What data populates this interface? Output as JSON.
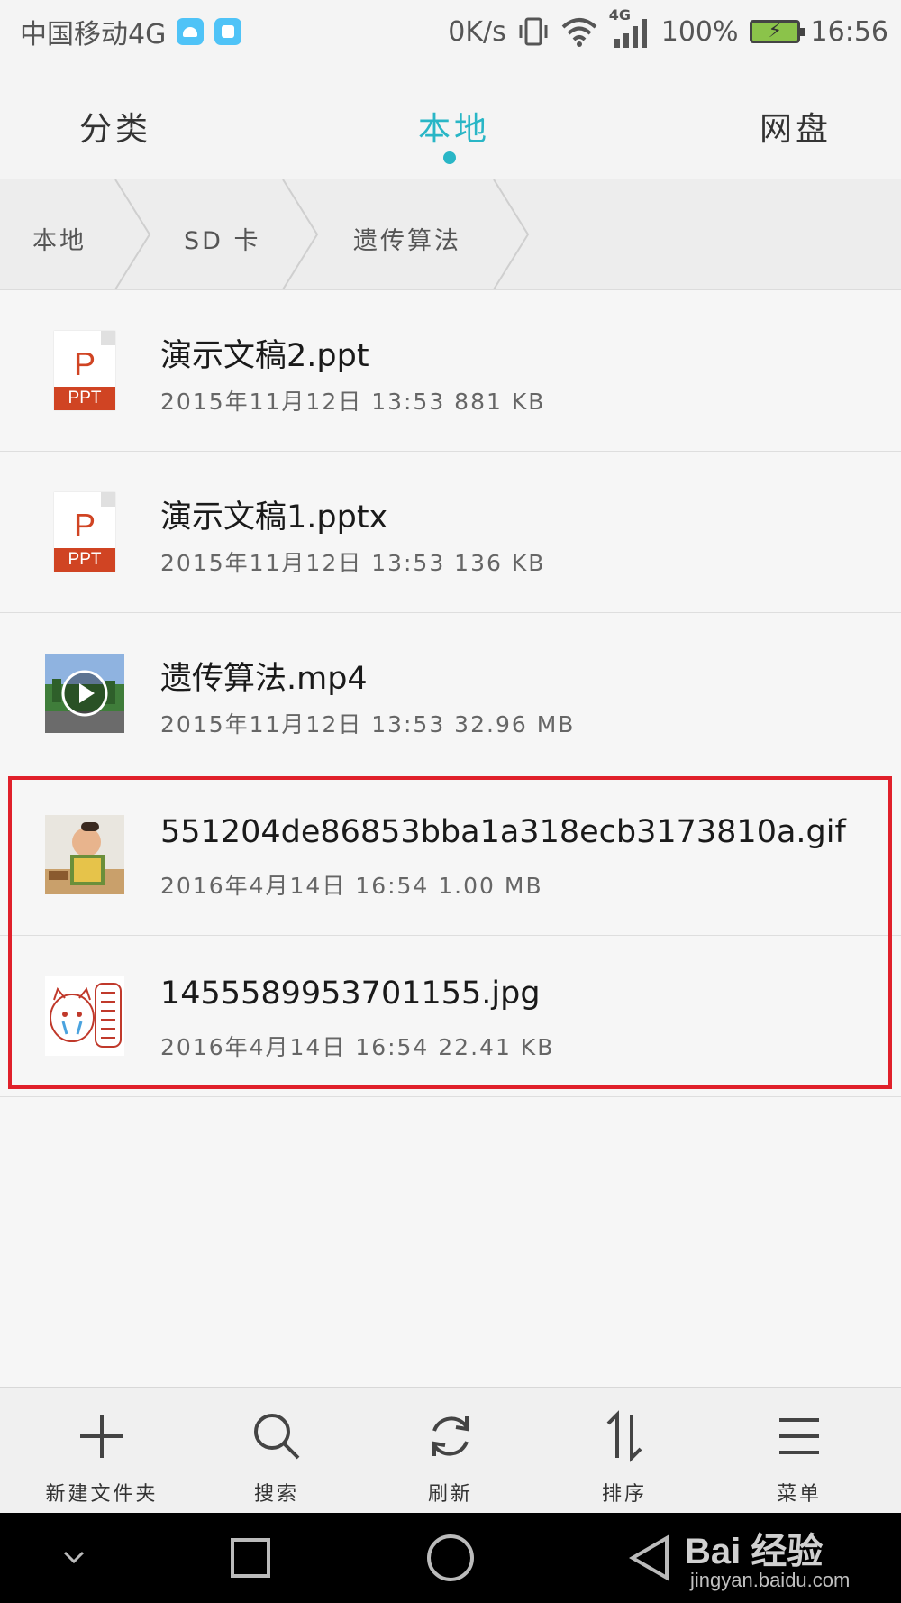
{
  "status_bar": {
    "carrier": "中国移动4G",
    "speed": "0K/s",
    "network": "4G",
    "battery": "100%",
    "time": "16:56"
  },
  "tabs": [
    {
      "label": "分类",
      "active": false
    },
    {
      "label": "本地",
      "active": true
    },
    {
      "label": "网盘",
      "active": false
    }
  ],
  "breadcrumb": [
    "本地",
    "SD 卡",
    "遗传算法"
  ],
  "files": [
    {
      "name": "演示文稿2.ppt",
      "meta": "2015年11月12日 13:53 881 KB",
      "icon": "ppt-icon",
      "badge": "PPT",
      "letter": "P"
    },
    {
      "name": "演示文稿1.pptx",
      "meta": "2015年11月12日 13:53 136 KB",
      "icon": "ppt-icon",
      "badge": "PPT",
      "letter": "P"
    },
    {
      "name": "遗传算法.mp4",
      "meta": "2015年11月12日 13:53 32.96 MB",
      "icon": "video-thumbnail"
    },
    {
      "name": "551204de86853bba1a318ecb3173810a.gif",
      "meta": "2016年4月14日 16:54 1.00 MB",
      "icon": "gif-thumbnail"
    },
    {
      "name": "1455589953701155.jpg",
      "meta": "2016年4月14日 16:54 22.41 KB",
      "icon": "jpg-thumbnail"
    }
  ],
  "toolbar": [
    {
      "label": "新建文件夹",
      "icon": "plus-icon"
    },
    {
      "label": "搜索",
      "icon": "search-icon"
    },
    {
      "label": "刷新",
      "icon": "refresh-icon"
    },
    {
      "label": "排序",
      "icon": "sort-icon"
    },
    {
      "label": "菜单",
      "icon": "menu-icon"
    }
  ],
  "watermark": {
    "brand": "Bai 经验",
    "url": "jingyan.baidu.com"
  },
  "colors": {
    "accent": "#29b6c6",
    "highlight": "#e0202a",
    "ppt": "#d04423"
  }
}
